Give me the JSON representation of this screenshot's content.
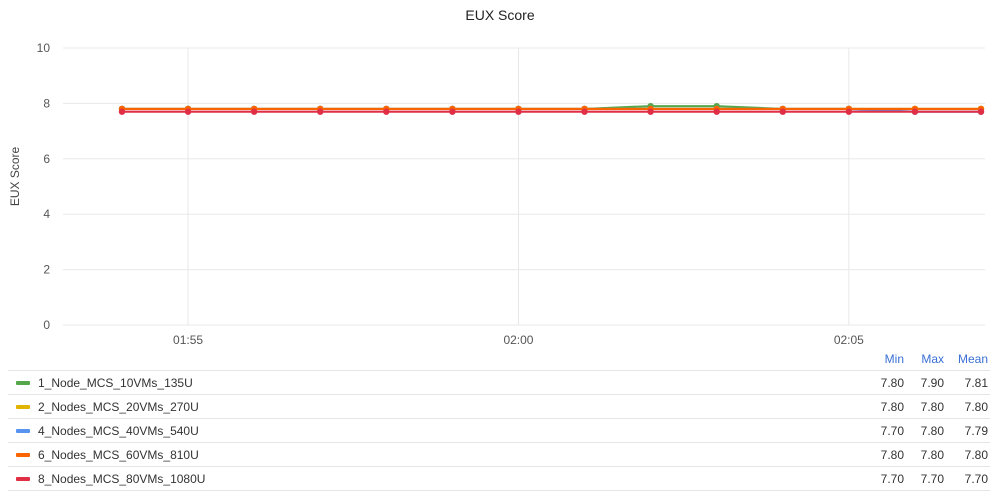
{
  "chart_data": {
    "type": "line",
    "title": "EUX Score",
    "ylabel": "EUX Score",
    "xlabel": "",
    "ylim": [
      0,
      10
    ],
    "yticks": [
      "0",
      "2",
      "4",
      "6",
      "8",
      "10"
    ],
    "x": [
      "01:54",
      "01:55",
      "01:56",
      "01:57",
      "01:58",
      "01:59",
      "02:00",
      "02:01",
      "02:02",
      "02:03",
      "02:04",
      "02:05",
      "02:06",
      "02:07"
    ],
    "xlim": [
      "01:54",
      "02:07"
    ],
    "xticks": [
      "01:55",
      "02:00",
      "02:05"
    ],
    "grid": true,
    "legend_position": "bottom",
    "series": [
      {
        "name": "1_Node_MCS_10VMs_135U",
        "color": "#56a64b",
        "values": [
          7.8,
          7.8,
          7.8,
          7.8,
          7.8,
          7.8,
          7.8,
          7.8,
          7.9,
          7.9,
          7.8,
          7.8,
          7.8,
          7.8
        ]
      },
      {
        "name": "2_Nodes_MCS_20VMs_270U",
        "color": "#e0b400",
        "values": [
          7.8,
          7.8,
          7.8,
          7.8,
          7.8,
          7.8,
          7.8,
          7.8,
          7.8,
          7.8,
          7.8,
          7.8,
          7.8,
          7.8
        ]
      },
      {
        "name": "4_Nodes_MCS_40VMs_540U",
        "color": "#5794f2",
        "values": [
          7.8,
          7.8,
          7.8,
          7.8,
          7.8,
          7.8,
          7.8,
          7.8,
          7.8,
          7.8,
          7.8,
          7.8,
          7.7,
          7.7
        ]
      },
      {
        "name": "6_Nodes_MCS_60VMs_810U",
        "color": "#fa6400",
        "values": [
          7.8,
          7.8,
          7.8,
          7.8,
          7.8,
          7.8,
          7.8,
          7.8,
          7.8,
          7.8,
          7.8,
          7.8,
          7.8,
          7.8
        ]
      },
      {
        "name": "8_Nodes_MCS_80VMs_1080U",
        "color": "#e02f44",
        "values": [
          7.7,
          7.7,
          7.7,
          7.7,
          7.7,
          7.7,
          7.7,
          7.7,
          7.7,
          7.7,
          7.7,
          7.7,
          7.7,
          7.7
        ]
      }
    ]
  },
  "legend": {
    "headers": {
      "min": "Min",
      "max": "Max",
      "mean": "Mean"
    },
    "rows": [
      {
        "name": "1_Node_MCS_10VMs_135U",
        "min": "7.80",
        "max": "7.90",
        "mean": "7.81"
      },
      {
        "name": "2_Nodes_MCS_20VMs_270U",
        "min": "7.80",
        "max": "7.80",
        "mean": "7.80"
      },
      {
        "name": "4_Nodes_MCS_40VMs_540U",
        "min": "7.70",
        "max": "7.80",
        "mean": "7.79"
      },
      {
        "name": "6_Nodes_MCS_60VMs_810U",
        "min": "7.80",
        "max": "7.80",
        "mean": "7.80"
      },
      {
        "name": "8_Nodes_MCS_80VMs_1080U",
        "min": "7.70",
        "max": "7.70",
        "mean": "7.70"
      }
    ]
  }
}
